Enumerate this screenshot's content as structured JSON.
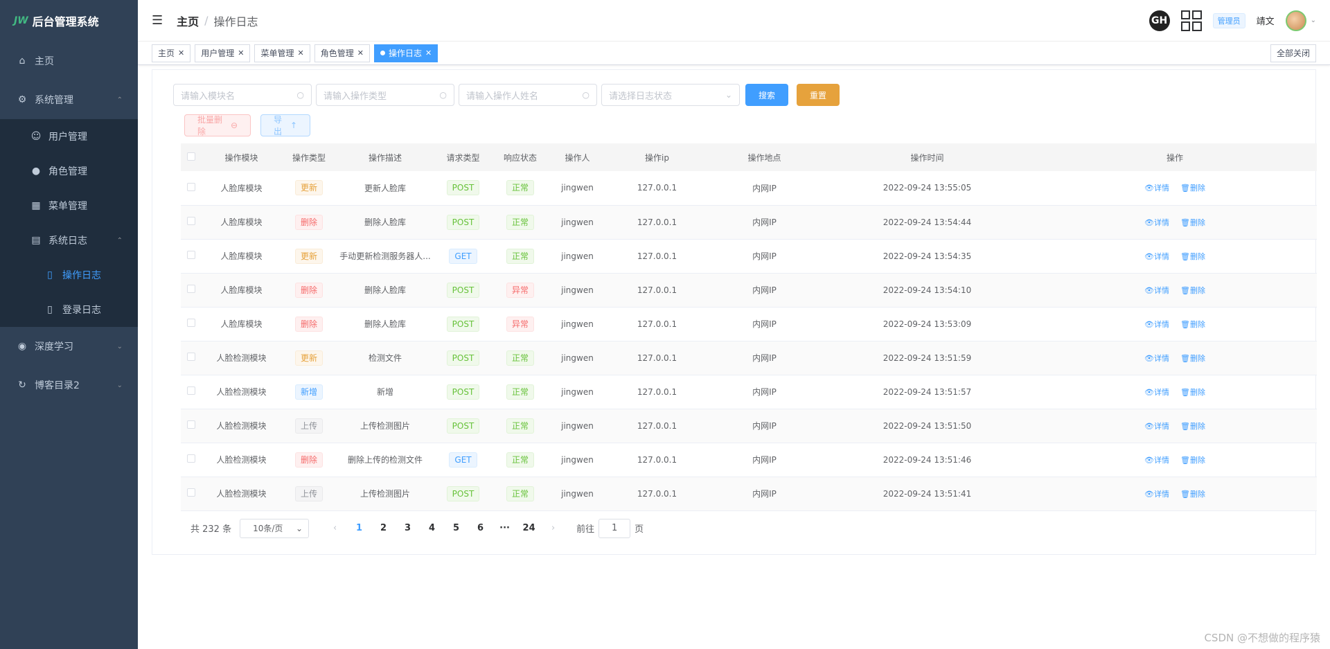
{
  "app": {
    "title": "后台管理系统",
    "logo_mark": "JW"
  },
  "sidebar": {
    "items": [
      {
        "label": "主页",
        "icon": "home-icon"
      },
      {
        "label": "系统管理",
        "icon": "gear-icon",
        "expanded": true
      },
      {
        "label": "用户管理",
        "icon": "user-icon"
      },
      {
        "label": "角色管理",
        "icon": "user-solid-icon"
      },
      {
        "label": "菜单管理",
        "icon": "grid-menu-icon"
      },
      {
        "label": "系统日志",
        "icon": "calendar-icon",
        "expanded": true
      },
      {
        "label": "操作日志",
        "icon": "document-icon",
        "active": true
      },
      {
        "label": "登录日志",
        "icon": "document-icon"
      },
      {
        "label": "深度学习",
        "icon": "camera-icon"
      },
      {
        "label": "博客目录2",
        "icon": "refresh-icon"
      }
    ]
  },
  "navbar": {
    "breadcrumb_home": "主页",
    "breadcrumb_sep": "/",
    "breadcrumb_current": "操作日志",
    "github_label": "GH",
    "role": "管理员",
    "username": "靖文"
  },
  "tags": {
    "items": [
      "主页",
      "用户管理",
      "菜单管理",
      "角色管理",
      "操作日志"
    ],
    "close_all": "全部关闭"
  },
  "filters": {
    "module_placeholder": "请输入模块名",
    "type_placeholder": "请输入操作类型",
    "operator_placeholder": "请输入操作人姓名",
    "status_placeholder": "请选择日志状态",
    "search": "搜索",
    "reset": "重置",
    "batch_delete": "批量删除",
    "export": "导出"
  },
  "table": {
    "columns": [
      "操作模块",
      "操作类型",
      "操作描述",
      "请求类型",
      "响应状态",
      "操作人",
      "操作ip",
      "操作地点",
      "操作时间",
      "操作"
    ],
    "detail_label": "详情",
    "delete_label": "删除",
    "rows": [
      {
        "module": "人脸库模块",
        "type": "更新",
        "type_color": "warning",
        "desc": "更新人脸库",
        "method": "POST",
        "method_color": "success",
        "status": "正常",
        "status_color": "success",
        "operator": "jingwen",
        "ip": "127.0.0.1",
        "location": "内网IP",
        "time": "2022-09-24 13:55:05"
      },
      {
        "module": "人脸库模块",
        "type": "删除",
        "type_color": "danger",
        "desc": "删除人脸库",
        "method": "POST",
        "method_color": "success",
        "status": "正常",
        "status_color": "success",
        "operator": "jingwen",
        "ip": "127.0.0.1",
        "location": "内网IP",
        "time": "2022-09-24 13:54:44"
      },
      {
        "module": "人脸库模块",
        "type": "更新",
        "type_color": "warning",
        "desc": "手动更新检测服务器人...",
        "method": "GET",
        "method_color": "primary",
        "status": "正常",
        "status_color": "success",
        "operator": "jingwen",
        "ip": "127.0.0.1",
        "location": "内网IP",
        "time": "2022-09-24 13:54:35"
      },
      {
        "module": "人脸库模块",
        "type": "删除",
        "type_color": "danger",
        "desc": "删除人脸库",
        "method": "POST",
        "method_color": "success",
        "status": "异常",
        "status_color": "danger",
        "operator": "jingwen",
        "ip": "127.0.0.1",
        "location": "内网IP",
        "time": "2022-09-24 13:54:10"
      },
      {
        "module": "人脸库模块",
        "type": "删除",
        "type_color": "danger",
        "desc": "删除人脸库",
        "method": "POST",
        "method_color": "success",
        "status": "异常",
        "status_color": "danger",
        "operator": "jingwen",
        "ip": "127.0.0.1",
        "location": "内网IP",
        "time": "2022-09-24 13:53:09"
      },
      {
        "module": "人脸检测模块",
        "type": "更新",
        "type_color": "warning",
        "desc": "检测文件",
        "method": "POST",
        "method_color": "success",
        "status": "正常",
        "status_color": "success",
        "operator": "jingwen",
        "ip": "127.0.0.1",
        "location": "内网IP",
        "time": "2022-09-24 13:51:59"
      },
      {
        "module": "人脸检测模块",
        "type": "新增",
        "type_color": "primary",
        "desc": "新增",
        "method": "POST",
        "method_color": "success",
        "status": "正常",
        "status_color": "success",
        "operator": "jingwen",
        "ip": "127.0.0.1",
        "location": "内网IP",
        "time": "2022-09-24 13:51:57"
      },
      {
        "module": "人脸检测模块",
        "type": "上传",
        "type_color": "info",
        "desc": "上传检测图片",
        "method": "POST",
        "method_color": "success",
        "status": "正常",
        "status_color": "success",
        "operator": "jingwen",
        "ip": "127.0.0.1",
        "location": "内网IP",
        "time": "2022-09-24 13:51:50"
      },
      {
        "module": "人脸检测模块",
        "type": "删除",
        "type_color": "danger",
        "desc": "删除上传的检测文件",
        "method": "GET",
        "method_color": "primary",
        "status": "正常",
        "status_color": "success",
        "operator": "jingwen",
        "ip": "127.0.0.1",
        "location": "内网IP",
        "time": "2022-09-24 13:51:46"
      },
      {
        "module": "人脸检测模块",
        "type": "上传",
        "type_color": "info",
        "desc": "上传检测图片",
        "method": "POST",
        "method_color": "success",
        "status": "正常",
        "status_color": "success",
        "operator": "jingwen",
        "ip": "127.0.0.1",
        "location": "内网IP",
        "time": "2022-09-24 13:51:41"
      }
    ]
  },
  "pagination": {
    "total": "共 232 条",
    "page_size": "10条/页",
    "pages": [
      "1",
      "2",
      "3",
      "4",
      "5",
      "6",
      "···",
      "24"
    ],
    "current": "1",
    "goto_prefix": "前往",
    "goto_value": "1",
    "goto_suffix": "页"
  },
  "watermark": "CSDN @不想做的程序猿"
}
